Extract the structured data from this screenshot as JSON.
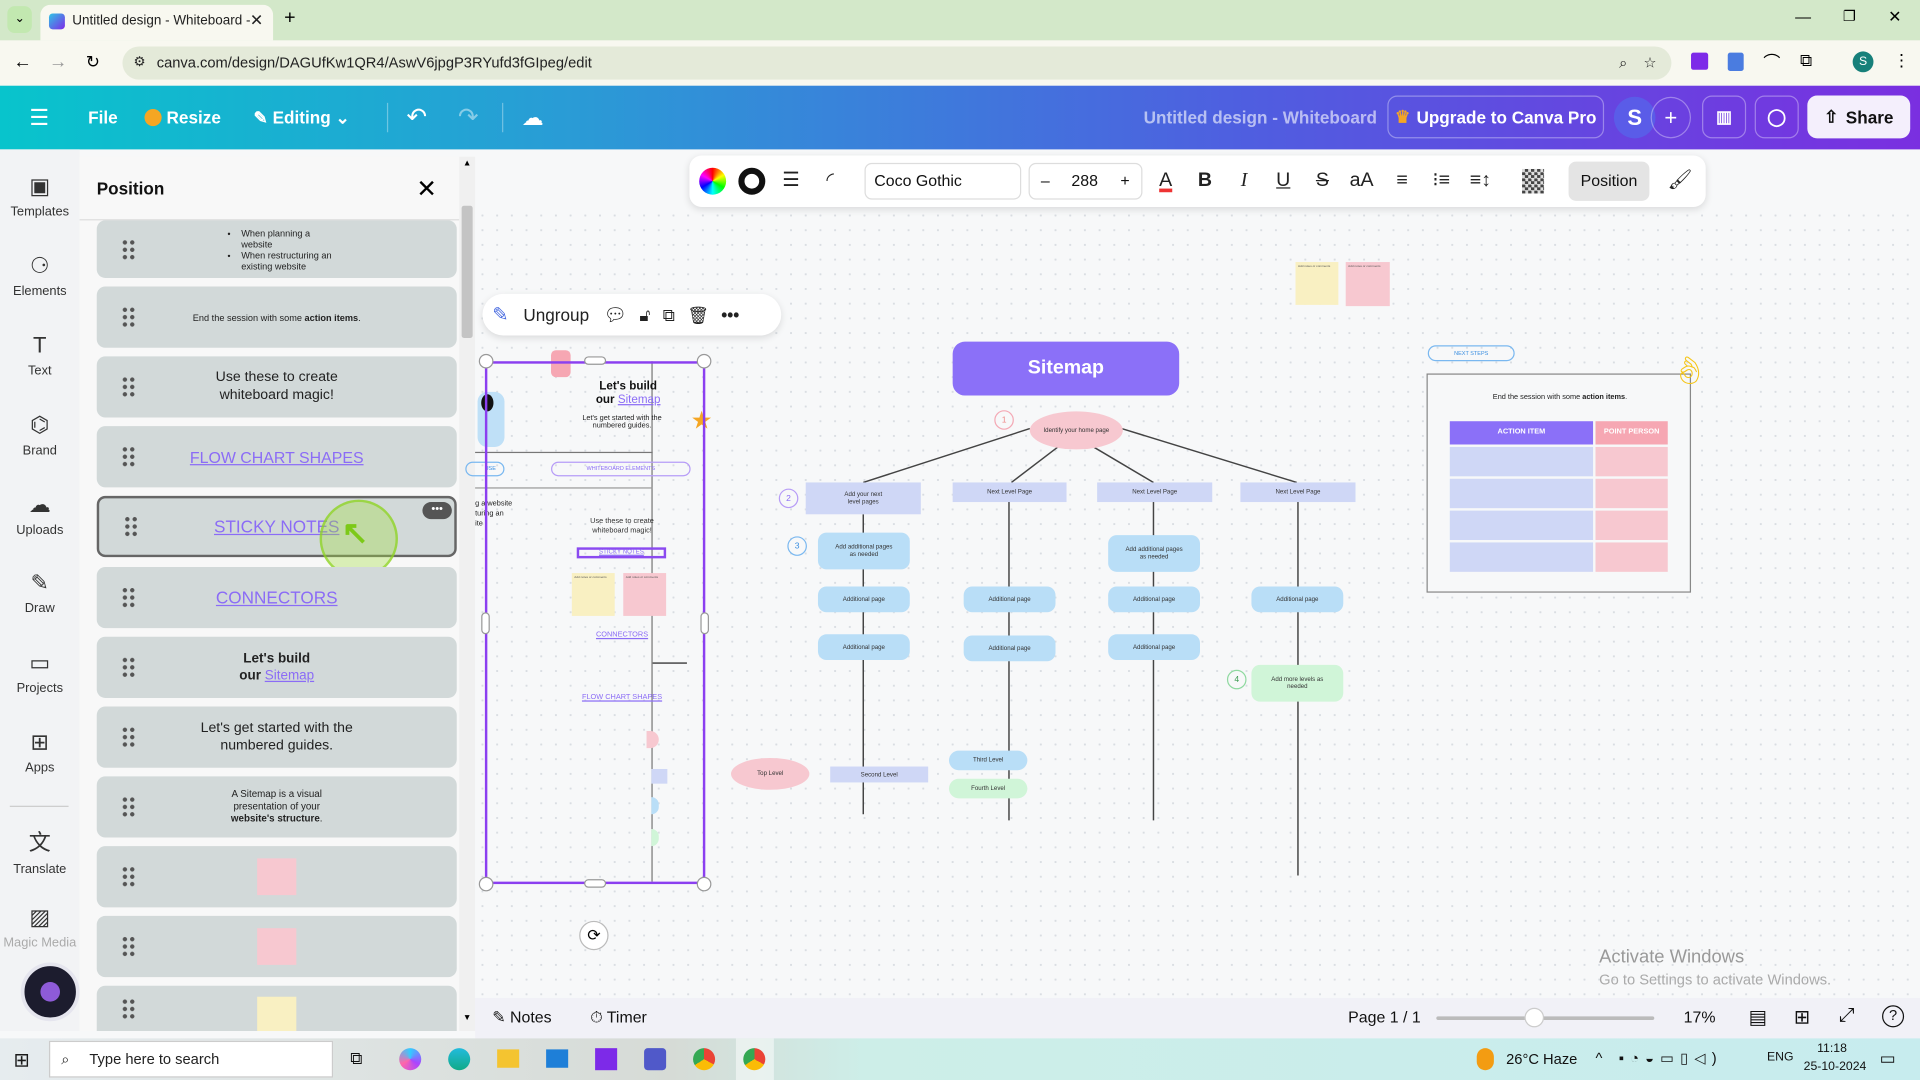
{
  "browser": {
    "tab_title": "Untitled design - Whiteboard -",
    "url": "canva.com/design/DAGUfKw1QR4/AswV6jpgP3RYufd3fGIpeg/edit",
    "profile_initial": "S"
  },
  "header": {
    "file": "File",
    "resize": "Resize",
    "editing": "Editing",
    "doc_title": "Untitled design - Whiteboard",
    "upgrade": "Upgrade to Canva Pro",
    "avatar_initial": "S",
    "share": "Share"
  },
  "rail": {
    "items": [
      {
        "label": "Templates",
        "icon": "templates-icon"
      },
      {
        "label": "Elements",
        "icon": "elements-icon"
      },
      {
        "label": "Text",
        "icon": "text-icon"
      },
      {
        "label": "Brand",
        "icon": "brand-icon"
      },
      {
        "label": "Uploads",
        "icon": "uploads-icon"
      },
      {
        "label": "Draw",
        "icon": "draw-icon"
      },
      {
        "label": "Projects",
        "icon": "projects-icon"
      },
      {
        "label": "Apps",
        "icon": "apps-icon"
      },
      {
        "label": "Translate",
        "icon": "translate-icon"
      },
      {
        "label": "Magic Media",
        "icon": "magic-media-icon"
      }
    ]
  },
  "panel": {
    "title": "Position",
    "layers": {
      "l0a": "When planning a website",
      "l0b": "When restructuring an existing website",
      "l1a": "End the session with some ",
      "l1b": "action items",
      "l1c": ".",
      "l2": "Use these to create whiteboard magic!",
      "l3": "FLOW CHART SHAPES",
      "l4": "STICKY NOTES",
      "l5": "CONNECTORS",
      "l6a": "Let's build",
      "l6b": "our ",
      "l6c": "Sitemap",
      "l7": "Let's get started with the numbered guides.",
      "l8a": "A Sitemap is a visual presentation of your ",
      "l8b": "website's structure",
      "l8c": "."
    }
  },
  "format_toolbar": {
    "font": "Coco Gothic",
    "font_size": "288",
    "position": "Position"
  },
  "context_toolbar": {
    "ungroup": "Ungroup"
  },
  "canvas": {
    "frame": {
      "heading1": "Let's build",
      "heading2": "our ",
      "heading_link": "Sitemap",
      "sub": "Let's get started with the numbered guides.",
      "pill_left": "USE",
      "pill": "WHITEBOARD ELEMENTS",
      "left_text": "g a website\nturing an\nite",
      "magic": "Use these to create whiteboard magic!",
      "sticky": "STICKY NOTES",
      "connectors": "CONNECTORS",
      "flow": "FLOW CHART SHAPES",
      "note": "Add notes or comments"
    },
    "sitemap": {
      "title": "Sitemap",
      "home": "Identify your home page",
      "level2": [
        "Add your next level pages",
        "Next Level Page",
        "Next Level Page",
        "Next Level Page"
      ],
      "add_pages": "Add additional pages as needed",
      "additional": "Additional page",
      "more_levels": "Add more levels as needed",
      "numbers": [
        "1",
        "2",
        "3",
        "4"
      ]
    },
    "legend": {
      "top": "Top Level",
      "second": "Second Level",
      "third": "Third Level",
      "fourth": "Fourth Level"
    },
    "next_steps": {
      "pill": "NEXT STEPS",
      "text_a": "End the session with some ",
      "text_b": "action items",
      "text_c": ".",
      "col1": "ACTION ITEM",
      "col2": "POINT PERSON"
    },
    "watermark": {
      "line1": "Activate Windows",
      "line2": "Go to Settings to activate Windows."
    }
  },
  "bottom": {
    "notes": "Notes",
    "timer": "Timer",
    "page": "Page 1 / 1",
    "zoom": "17%",
    "zoom_slider_fraction": 0.45
  },
  "taskbar": {
    "search_placeholder": "Type here to search",
    "weather": "26°C  Haze",
    "lang": "ENG",
    "time": "11:18",
    "date": "25-10-2024"
  },
  "colors": {
    "accent": "#8b6cf6",
    "selection": "#7d2ae8",
    "pink": "#f7c8d0",
    "lavender": "#cfd7f6",
    "blue": "#b9def7",
    "green": "#d0f5d8"
  }
}
